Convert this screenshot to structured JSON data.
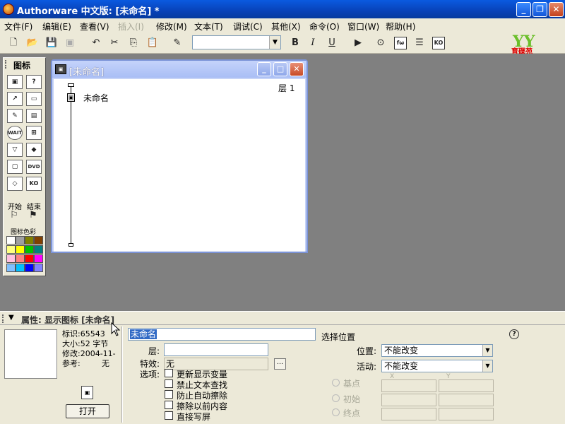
{
  "app": {
    "title": "Authorware 中文版: [未命名] *"
  },
  "window_controls": {
    "minimize": "_",
    "restore": "❐",
    "close": "✕"
  },
  "menu": {
    "items": [
      {
        "label": "文件(F)"
      },
      {
        "label": "编辑(E)"
      },
      {
        "label": "查看(V)"
      },
      {
        "label": "插入(I)",
        "disabled": true
      },
      {
        "label": "修改(M)"
      },
      {
        "label": "文本(T)"
      },
      {
        "label": "调试(C)"
      },
      {
        "label": "其他(X)"
      },
      {
        "label": "命令(O)"
      },
      {
        "label": "窗口(W)"
      },
      {
        "label": "帮助(H)"
      }
    ]
  },
  "toolbar": {
    "bold": "B",
    "italic": "I",
    "underline": "U",
    "functions_btn": "fω",
    "ko_btn": "KO",
    "font_value": ""
  },
  "logo": {
    "mark": "YY",
    "text": "育碟苑"
  },
  "palette": {
    "title": "图标",
    "start_label": "开始",
    "end_label": "结束",
    "colors_label": "图标色彩",
    "wait_label": "WAIT",
    "dvd_label": "DVD",
    "ko_label": "KO",
    "swatches": [
      "#ffffff",
      "#a0a0a0",
      "#808000",
      "#804000",
      "#ffff80",
      "#ffff00",
      "#00c000",
      "#008080",
      "#ffc0e0",
      "#ff8080",
      "#ff0000",
      "#ff00ff",
      "#80c0ff",
      "#00c0ff",
      "#0000ff",
      "#8080ff"
    ]
  },
  "flow_window": {
    "title": "[未命名]",
    "layer": "层 1",
    "icon_label": "未命名"
  },
  "props": {
    "title": "属性: 显示图标 [未命名]",
    "id_label": "标识:65543",
    "size_label": "大小:52 字节",
    "modified_label": "修改:2004-11-",
    "ref_label": "参考:",
    "ref_value": "无",
    "open_button": "打开",
    "name_value": "未命名",
    "layer_label": "层:",
    "layer_value": "",
    "effect_label": "特效:",
    "effect_value": "无",
    "options_label": "选项:",
    "options": [
      {
        "label": "更新显示变量"
      },
      {
        "label": "禁止文本查找"
      },
      {
        "label": "防止自动擦除"
      },
      {
        "label": "擦除以前内容"
      },
      {
        "label": "直接写屏"
      }
    ],
    "select_position_label": "选择位置",
    "position_label": "位置:",
    "position_value": "不能改变",
    "active_label": "活动:",
    "active_value": "不能改变",
    "base_label": "基点",
    "initial_label": "初始",
    "end_label": "终点",
    "x_head": "X",
    "y_head": "Y",
    "help": "?"
  }
}
